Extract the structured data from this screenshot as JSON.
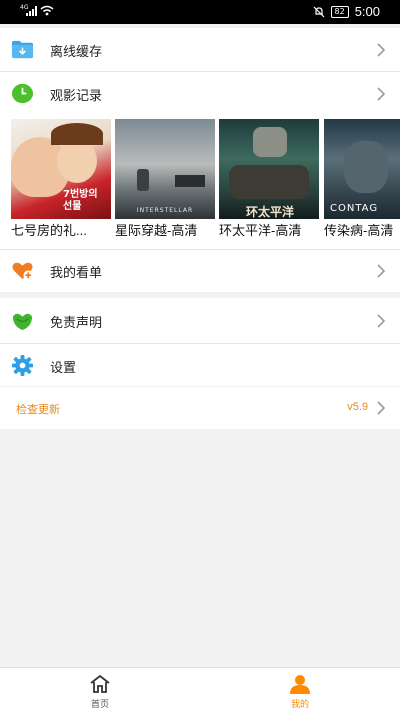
{
  "status_bar": {
    "network": "4G",
    "battery": "82",
    "time": "5:00"
  },
  "menu": {
    "offline_cache": "离线缓存",
    "watch_history": "观影记录",
    "my_list": "我的看单",
    "disclaimer": "免责声明",
    "settings": "设置",
    "check_update": "检查更新",
    "version": "v5.9"
  },
  "history": [
    {
      "title": "七号房的礼...",
      "poster_text": "7번방의 선물"
    },
    {
      "title": "星际穿越-高清",
      "poster_text": "INTERSTELLAR"
    },
    {
      "title": "环太平洋-高清",
      "poster_text": "环太平洋"
    },
    {
      "title": "传染病-高清",
      "poster_text": "CONTAG"
    }
  ],
  "tabs": {
    "home": "首页",
    "mine": "我的"
  },
  "colors": {
    "accent": "#ff8a00",
    "update_text": "#e8891b",
    "cache_icon": "#3ea3e6",
    "history_icon": "#4cc02c"
  }
}
